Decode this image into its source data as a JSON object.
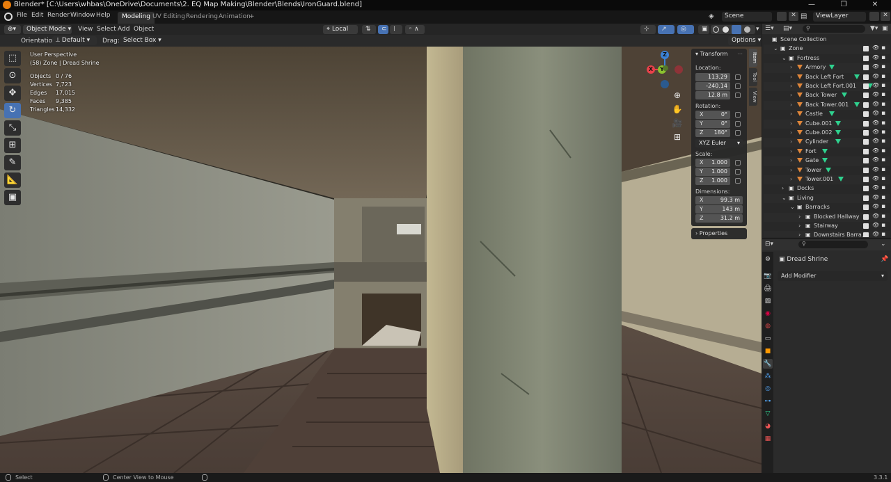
{
  "window": {
    "title": "Blender* [C:\\Users\\whbas\\OneDrive\\Documents\\2. EQ Map Making\\Blender\\Blends\\IronGuard.blend]",
    "controls": [
      "—",
      "❐",
      "✕"
    ]
  },
  "menu": {
    "items": [
      "File",
      "Edit",
      "Render",
      "Window",
      "Help"
    ],
    "workspaces": [
      "Modeling",
      "UV Editing",
      "Rendering",
      "Animation"
    ],
    "add_workspace": "+",
    "scene": "Scene",
    "view_layer": "ViewLayer"
  },
  "viewport_header": {
    "mode": "Object Mode",
    "menus": [
      "View",
      "Select",
      "Add",
      "Object"
    ],
    "transform_orientation": "Local",
    "options_label": "Options"
  },
  "tool_settings": {
    "orientation_label": "Orientation:",
    "orientation_value": "Default",
    "drag_label": "Drag:",
    "drag_value": "Select Box"
  },
  "overlay": {
    "view_name": "User Perspective",
    "collection_object": "(58) Zone | Dread Shrine",
    "stats": [
      {
        "label": "Objects",
        "value": "0 / 76"
      },
      {
        "label": "Vertices",
        "value": "7,723"
      },
      {
        "label": "Edges",
        "value": "17,015"
      },
      {
        "label": "Faces",
        "value": "9,385"
      },
      {
        "label": "Triangles",
        "value": "14,332"
      }
    ]
  },
  "gizmo": {
    "x": "X",
    "y": "Y",
    "z": "Z"
  },
  "sidebar": {
    "tabs": [
      "Item",
      "Tool",
      "View"
    ],
    "transform_title": "Transform",
    "location_label": "Location:",
    "location": [
      "113.29",
      "-240.14",
      "12.8 m"
    ],
    "rotation_label": "Rotation:",
    "rotation": [
      {
        "axis": "X",
        "value": "0°"
      },
      {
        "axis": "Y",
        "value": "0°"
      },
      {
        "axis": "Z",
        "value": "180°"
      }
    ],
    "rotation_mode": "XYZ Euler",
    "scale_label": "Scale:",
    "scale": [
      {
        "axis": "X",
        "value": "1.000"
      },
      {
        "axis": "Y",
        "value": "1.000"
      },
      {
        "axis": "Z",
        "value": "1.000"
      }
    ],
    "dimensions_label": "Dimensions:",
    "dimensions": [
      {
        "axis": "X",
        "value": "99.3 m"
      },
      {
        "axis": "Y",
        "value": "143 m"
      },
      {
        "axis": "Z",
        "value": "31.2 m"
      }
    ],
    "properties_title": "Properties"
  },
  "outliner": {
    "rows": [
      {
        "name": "Scene Collection",
        "indent": 0,
        "type": "scene"
      },
      {
        "name": "Zone",
        "indent": 1,
        "type": "collection"
      },
      {
        "name": "Fortress",
        "indent": 2,
        "type": "collection"
      },
      {
        "name": "Armory",
        "indent": 3,
        "type": "mesh"
      },
      {
        "name": "Back Left Fort",
        "indent": 3,
        "type": "mesh"
      },
      {
        "name": "Back Left Fort.001",
        "indent": 3,
        "type": "mesh"
      },
      {
        "name": "Back Tower",
        "indent": 3,
        "type": "mesh"
      },
      {
        "name": "Back Tower.001",
        "indent": 3,
        "type": "mesh"
      },
      {
        "name": "Castle",
        "indent": 3,
        "type": "mesh"
      },
      {
        "name": "Cube.001",
        "indent": 3,
        "type": "mesh"
      },
      {
        "name": "Cube.002",
        "indent": 3,
        "type": "mesh"
      },
      {
        "name": "Cylinder",
        "indent": 3,
        "type": "mesh"
      },
      {
        "name": "Fort",
        "indent": 3,
        "type": "mesh"
      },
      {
        "name": "Gate",
        "indent": 3,
        "type": "mesh"
      },
      {
        "name": "Tower",
        "indent": 3,
        "type": "mesh"
      },
      {
        "name": "Tower.001",
        "indent": 3,
        "type": "mesh"
      },
      {
        "name": "Docks",
        "indent": 2,
        "type": "collection"
      },
      {
        "name": "Living",
        "indent": 2,
        "type": "collection"
      },
      {
        "name": "Barracks",
        "indent": 3,
        "type": "collection"
      },
      {
        "name": "Blocked Hallway",
        "indent": 4,
        "type": "collection"
      },
      {
        "name": "Stairway",
        "indent": 4,
        "type": "collection"
      },
      {
        "name": "Downstairs Barra...",
        "indent": 4,
        "type": "collection"
      }
    ]
  },
  "properties": {
    "object_name": "Dread Shrine",
    "add_modifier": "Add Modifier"
  },
  "status_bar": {
    "left": "Select",
    "middle": "Center View to Mouse",
    "version": "3.3.1"
  },
  "colors": {
    "accent": "#4772b3",
    "axis_x": "#e8414a",
    "axis_y": "#8bc22f",
    "axis_z": "#3b82d6",
    "mesh_icon": "#e0863a",
    "data_icon": "#2fd28f"
  }
}
